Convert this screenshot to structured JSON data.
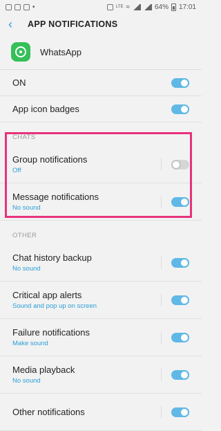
{
  "status_bar": {
    "battery": "64%",
    "time": "17:01"
  },
  "header": {
    "title": "APP NOTIFICATIONS"
  },
  "app": {
    "name": "WhatsApp"
  },
  "main_toggle": {
    "label": "ON",
    "on": true
  },
  "app_icon_badges": {
    "label": "App icon badges",
    "on": true
  },
  "sections": {
    "chats": "CHATS",
    "other": "OTHER"
  },
  "chats": [
    {
      "label": "Group notifications",
      "sub": "Off",
      "on": false
    },
    {
      "label": "Message notifications",
      "sub": "No sound",
      "on": true
    }
  ],
  "other": [
    {
      "label": "Chat history backup",
      "sub": "No sound",
      "on": true
    },
    {
      "label": "Critical app alerts",
      "sub": "Sound and pop up on screen",
      "on": true
    },
    {
      "label": "Failure notifications",
      "sub": "Make sound",
      "on": true
    },
    {
      "label": "Media playback",
      "sub": "No sound",
      "on": true
    },
    {
      "label": "Other notifications",
      "sub": "",
      "on": true
    }
  ],
  "colors": {
    "accent": "#2a9fd8",
    "toggle_on": "#5fb8e5",
    "highlight": "#e8327a",
    "whatsapp": "#35c05a"
  }
}
